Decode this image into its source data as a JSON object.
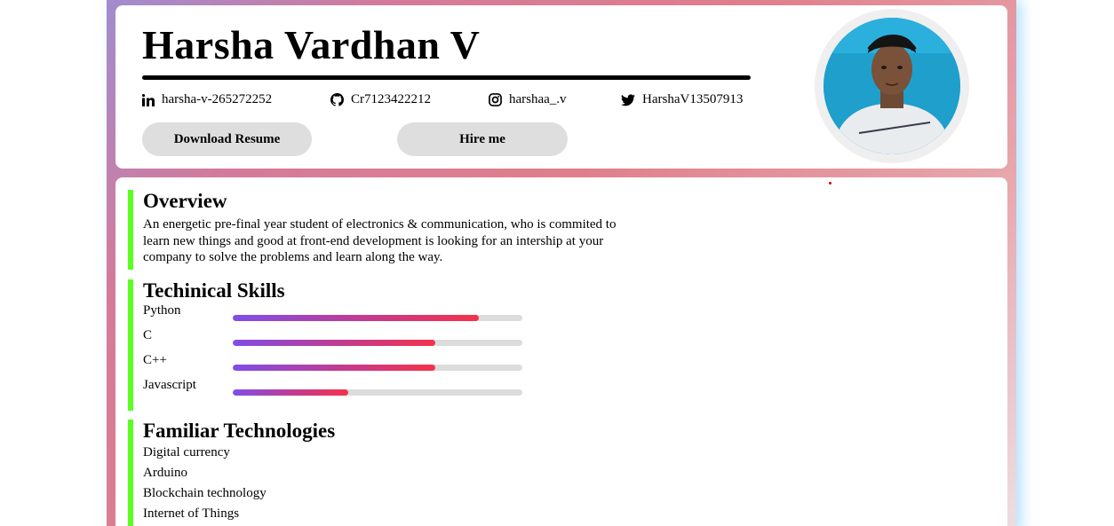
{
  "header": {
    "name": "Harsha Vardhan V",
    "socials": [
      {
        "icon": "linkedin-icon",
        "label": "harsha-v-265272252"
      },
      {
        "icon": "github-icon",
        "label": "Cr7123422212"
      },
      {
        "icon": "instagram-icon",
        "label": "harshaa_.v"
      },
      {
        "icon": "twitter-icon",
        "label": "HarshaV13507913"
      }
    ],
    "buttons": {
      "download_resume": "Download Resume",
      "hire_me": "Hire me"
    }
  },
  "overview": {
    "title": "Overview",
    "text": "An energetic pre-final year student of electronics & communication, who is commited to learn new things and good at front-end development is looking for an intership at your company to solve the problems and learn along the way."
  },
  "skills": {
    "title": "Techinical Skills",
    "items": [
      {
        "label": "Python",
        "level": 0.85
      },
      {
        "label": "C",
        "level": 0.7
      },
      {
        "label": "C++",
        "level": 0.7
      },
      {
        "label": "Javascript",
        "level": 0.4
      }
    ]
  },
  "technologies": {
    "title": "Familiar Technologies",
    "items": [
      "Digital currency",
      "Arduino",
      "Blockchain technology",
      "Internet of Things"
    ]
  },
  "colors": {
    "section_accent": "#5cff1f",
    "bar_gradient_start": "#7f4ee8",
    "bar_gradient_end": "#f5324b",
    "button_bg": "#dedede"
  }
}
